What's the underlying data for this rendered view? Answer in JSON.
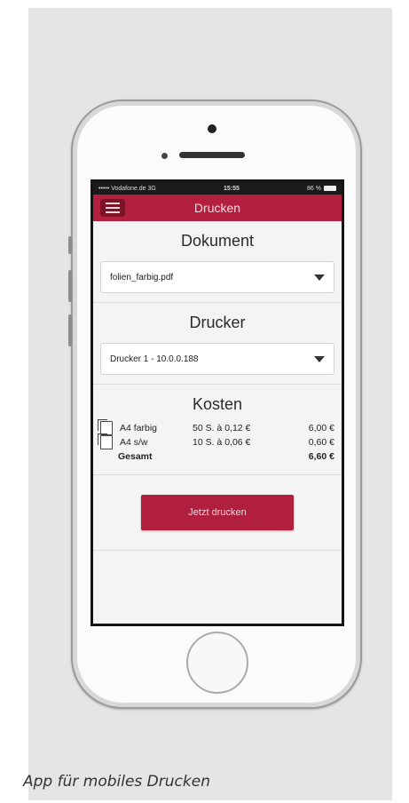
{
  "caption": "App für mobiles Drucken",
  "status_bar": {
    "carrier": "••••• Vodafone.de  3G",
    "time": "15:55",
    "battery": "86 %"
  },
  "navbar": {
    "title": "Drucken",
    "menu_icon": "list-icon"
  },
  "document_section": {
    "title": "Dokument",
    "selected": "folien_farbig.pdf"
  },
  "printer_section": {
    "title": "Drucker",
    "selected": "Drucker 1 - 10.0.0.188"
  },
  "costs_section": {
    "title": "Kosten",
    "rows": [
      {
        "name": "A4 farbig",
        "detail": "50 S. à 0,12 €",
        "price": "6,00 €"
      },
      {
        "name": "A4 s/w",
        "detail": "10 S. à 0,06 €",
        "price": "0,60 €"
      }
    ],
    "total_label": "Gesamt",
    "total_value": "6,60 €"
  },
  "print_button": "Jetzt drucken",
  "colors": {
    "accent": "#b3203f",
    "panel_bg": "#e5e5e5"
  }
}
